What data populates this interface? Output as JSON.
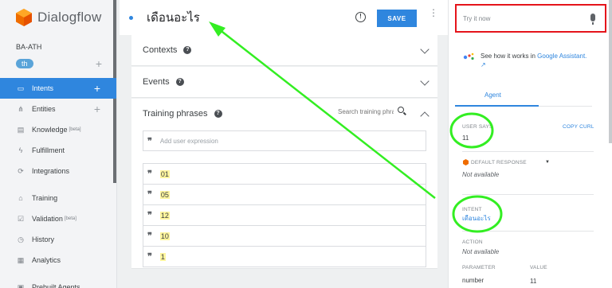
{
  "brand": {
    "name": "Dialogflow"
  },
  "agent": {
    "name": "BA-ATH",
    "language": "th"
  },
  "sidebar": {
    "items": [
      {
        "label": "Intents",
        "active": true,
        "has_add": true,
        "icon": "chat-icon"
      },
      {
        "label": "Entities",
        "has_add": true,
        "icon": "sitemap-icon"
      },
      {
        "label": "Knowledge",
        "badge": "[beta]",
        "icon": "book-icon"
      },
      {
        "label": "Fulfillment",
        "icon": "bolt-icon"
      },
      {
        "label": "Integrations",
        "icon": "sync-icon"
      },
      {
        "label": "Training",
        "icon": "graduation-cap-icon"
      },
      {
        "label": "Validation",
        "badge": "[beta]",
        "icon": "check-square-icon"
      },
      {
        "label": "History",
        "icon": "clock-icon"
      },
      {
        "label": "Analytics",
        "icon": "chart-icon"
      },
      {
        "label": "Prebuilt Agents",
        "icon": "box-icon"
      }
    ]
  },
  "intent": {
    "title": "เดือนอะไร",
    "save_label": "SAVE"
  },
  "sections": {
    "contexts": "Contexts",
    "events": "Events",
    "training": "Training phrases",
    "search_placeholder": "Search training phrases",
    "add_placeholder": "Add user expression"
  },
  "phrases": [
    "01",
    "05",
    "12",
    "10",
    "1"
  ],
  "test_console": {
    "try_placeholder": "Try it now",
    "ga_text": "See how it works in ",
    "ga_link": "Google Assistant.",
    "tab_agent": "Agent",
    "user_says_label": "USER SAYS",
    "copy_curl": "COPY CURL",
    "user_says_value": "11",
    "default_response_label": "DEFAULT RESPONSE",
    "default_response_value": "Not available",
    "intent_label": "INTENT",
    "intent_value": "เดือนอะไร",
    "action_label": "ACTION",
    "action_value": "Not available",
    "parameter_label": "PARAMETER",
    "value_label": "VALUE",
    "param_name": "number",
    "param_value": "11"
  },
  "colors": {
    "accent": "#2f86de",
    "highlight_box": "#e5141b",
    "annotation": "#33ee22"
  }
}
